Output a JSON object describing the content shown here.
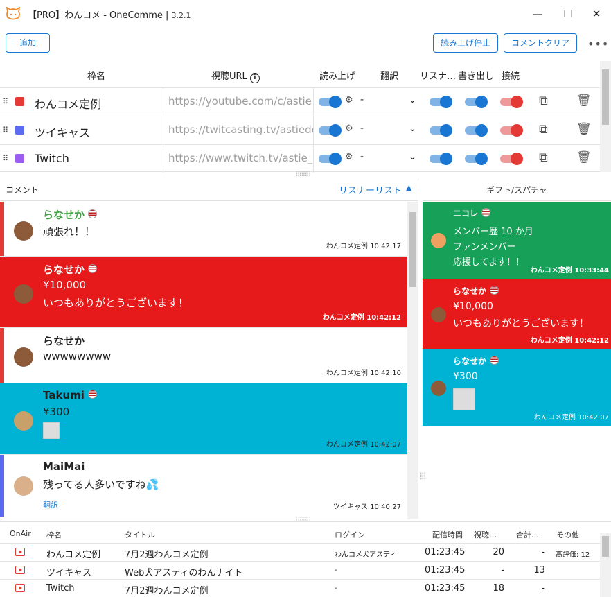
{
  "window": {
    "title": "【PRO】わんコメ - OneComme",
    "version": "3.2.1"
  },
  "toolbar": {
    "add_label": "追加",
    "stop_reading_label": "読み上げ停止",
    "clear_comments_label": "コメントクリア"
  },
  "frames": {
    "headers": {
      "name": "枠名",
      "url": "視聴URL",
      "read": "読み上げ",
      "translate": "翻訳",
      "listener": "リスナ…",
      "write": "書き出し",
      "connect": "接続"
    },
    "rows": [
      {
        "name": "わんコメ定例",
        "url": "https://youtube.com/c/astie",
        "color": "#e53935",
        "translate": "-"
      },
      {
        "name": "ツイキャス",
        "url": "https://twitcasting.tv/astiedog",
        "color": "#5c6bf0",
        "translate": "-"
      },
      {
        "name": "Twitch",
        "url": "https://www.twitch.tv/astie_dog",
        "color": "#9b5cf0",
        "translate": "-"
      }
    ]
  },
  "comments_panel": {
    "title": "コメント",
    "listener_link": "リスナーリスト",
    "items": [
      {
        "name": "らなせか",
        "lines": [
          "頑張れ！！"
        ],
        "source": "わんコメ定例",
        "time": "10:42:17",
        "bg": "#ffffff",
        "bar": "#e53935",
        "name_color": "#43a047"
      },
      {
        "name": "らなせか",
        "lines": [
          "¥10,000",
          "いつもありがとうございます！"
        ],
        "source": "わんコメ定例",
        "time": "10:42:12",
        "bg": "#e61a1a",
        "bar": "#e61a1a",
        "name_color": "#ffffff"
      },
      {
        "name": "らなせか",
        "lines": [
          "wwwwwwww"
        ],
        "source": "わんコメ定例",
        "time": "10:42:10",
        "bg": "#ffffff",
        "bar": "#e53935",
        "name_color": "#222222"
      },
      {
        "name": "Takumi",
        "lines": [
          "¥300"
        ],
        "source": "わんコメ定例",
        "time": "10:42:07",
        "bg": "#00b3d4",
        "bar": "#00b3d4",
        "name_color": "#222222"
      },
      {
        "name": "MaiMai",
        "lines": [
          "残ってる人多いですね💦"
        ],
        "translate_link": "翻訳",
        "source": "ツイキャス",
        "time": "10:40:27",
        "bg": "#ffffff",
        "bar": "#5c6bf0",
        "name_color": "#222222"
      }
    ]
  },
  "gifts_panel": {
    "title": "ギフト/スパチャ",
    "items": [
      {
        "name": "ニコレ",
        "lines": [
          "メンバー歴 10 か月",
          "ファンメンバー",
          "応援してます！！"
        ],
        "source": "わんコメ定例",
        "time": "10:33:44",
        "bg": "#17a058"
      },
      {
        "name": "らなせか",
        "lines": [
          "¥10,000",
          "いつもありがとうございます！"
        ],
        "source": "わんコメ定例",
        "time": "10:42:12",
        "bg": "#e61a1a"
      },
      {
        "name": "らなせか",
        "lines": [
          "¥300"
        ],
        "source": "わんコメ定例",
        "time": "10:42:07",
        "bg": "#00b3d4"
      }
    ]
  },
  "broadcasts": {
    "headers": {
      "onair": "OnAir",
      "name": "枠名",
      "title": "タイトル",
      "login": "ログイン",
      "duration": "配信時間",
      "viewers": "視聴…",
      "total": "合計…",
      "other": "その他"
    },
    "rows": [
      {
        "name": "わんコメ定例",
        "title": "7月2週わんコメ定例",
        "login": "わんコメ犬アスティ",
        "duration": "01:23:45",
        "viewers": "20",
        "total": "-",
        "other": "高評価: 12"
      },
      {
        "name": "ツイキャス",
        "title": "Web犬アスティのわんナイト",
        "login": "-",
        "duration": "01:23:45",
        "viewers": "-",
        "total": "13",
        "other": ""
      },
      {
        "name": "Twitch",
        "title": "7月2週わんコメ定例",
        "login": "-",
        "duration": "01:23:45",
        "viewers": "18",
        "total": "-",
        "other": ""
      }
    ]
  }
}
